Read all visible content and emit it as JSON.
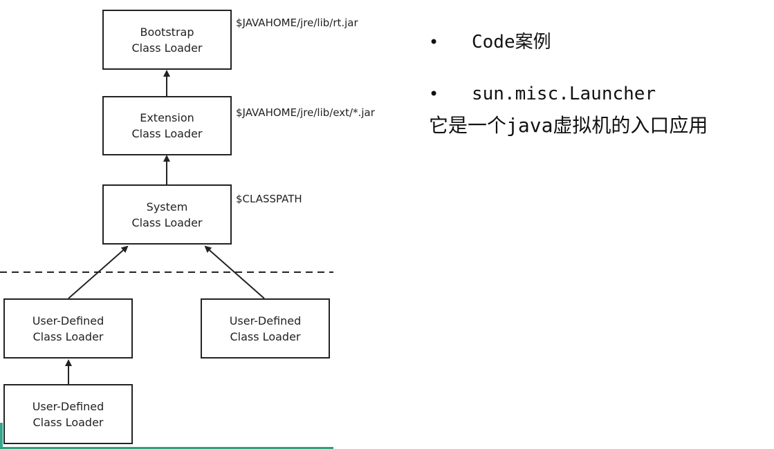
{
  "diagram": {
    "boxes": [
      {
        "id": "bootstrap",
        "line1": "Bootstrap",
        "line2": "Class Loader"
      },
      {
        "id": "extension",
        "line1": "Extension",
        "line2": "Class Loader"
      },
      {
        "id": "system",
        "line1": "System",
        "line2": "Class Loader"
      },
      {
        "id": "user1",
        "line1": "User-Defined",
        "line2": "Class Loader"
      },
      {
        "id": "user2",
        "line1": "User-Defined",
        "line2": "Class Loader"
      },
      {
        "id": "user3",
        "line1": "User-Defined",
        "line2": "Class Loader"
      }
    ],
    "path_labels": {
      "bootstrap": "$JAVAHOME/jre/lib/rt.jar",
      "extension": "$JAVAHOME/jre/lib/ext/*.jar",
      "system": "$CLASSPATH"
    },
    "colors": {
      "stroke": "#222222",
      "accent": "#2ea37c"
    }
  },
  "notes": {
    "bullet_symbol": "•",
    "item1": "Code案例",
    "item2": "sun.misc.Launcher",
    "item2_desc": "它是一个java虚拟机的入口应用"
  }
}
